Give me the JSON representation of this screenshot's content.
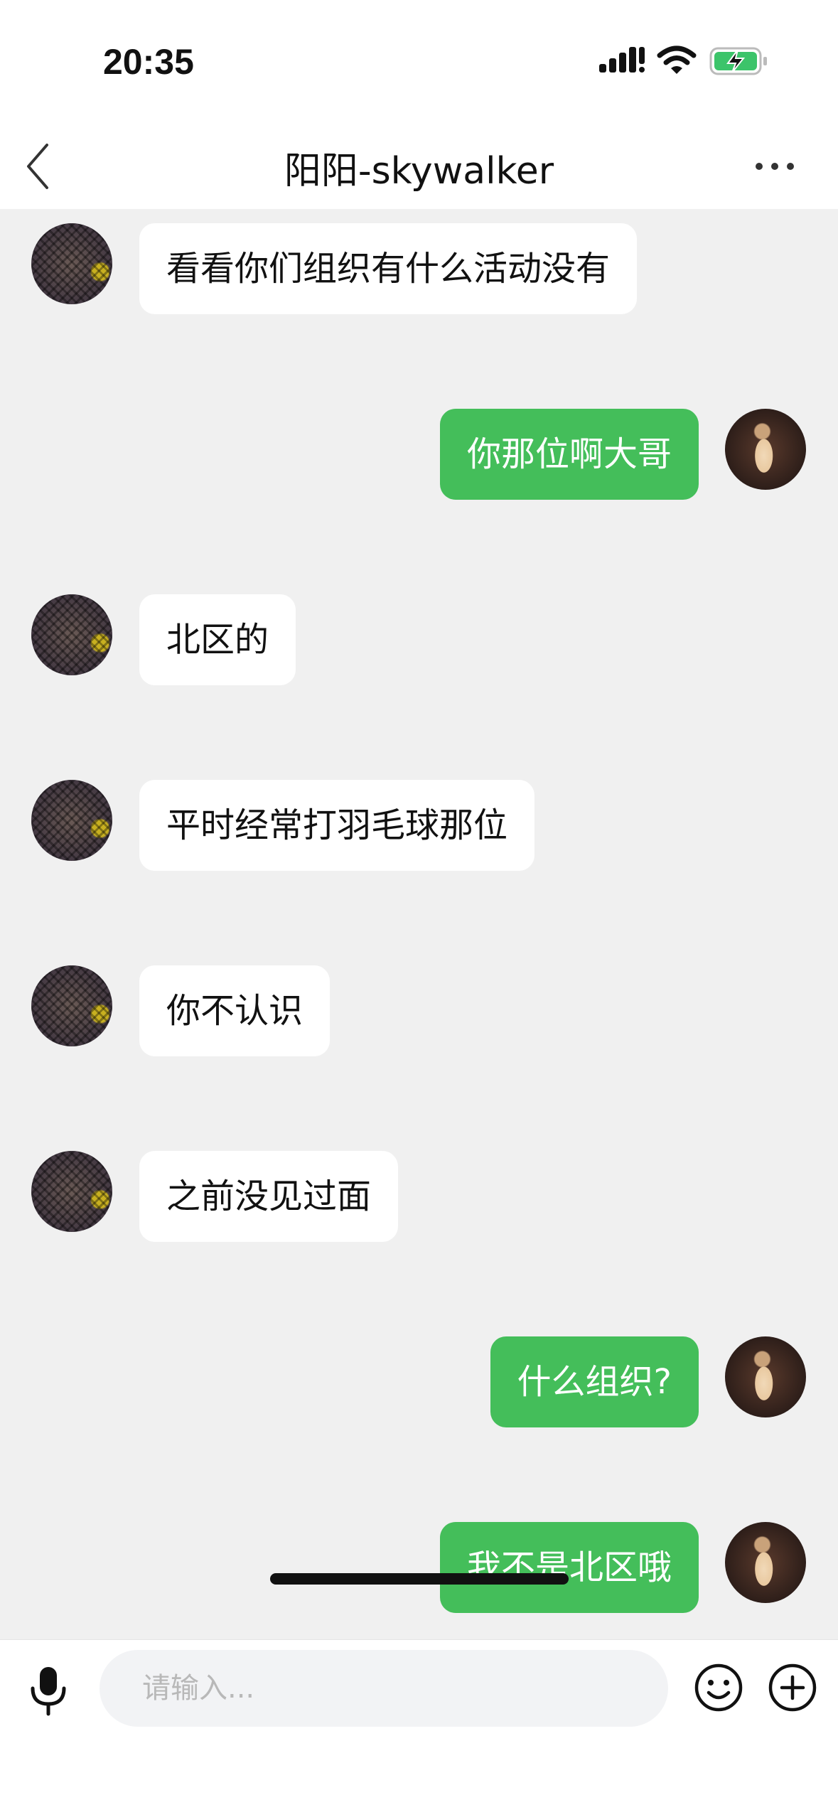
{
  "status_bar": {
    "time": "20:35"
  },
  "header": {
    "title": "阳阳-skywalker",
    "back_icon": "chevron-left-icon",
    "more_icon": "ellipsis-icon"
  },
  "messages": [
    {
      "side": "left",
      "text": "看看你们组织有什么活动没有"
    },
    {
      "side": "right",
      "text": "你那位啊大哥"
    },
    {
      "side": "left",
      "text": "北区的"
    },
    {
      "side": "left",
      "text": "平时经常打羽毛球那位"
    },
    {
      "side": "left",
      "text": "你不认识"
    },
    {
      "side": "left",
      "text": "之前没见过面"
    },
    {
      "side": "right",
      "text": "什么组织?"
    },
    {
      "side": "right",
      "text": "我不是北区哦"
    }
  ],
  "input_bar": {
    "placeholder": "请输入...",
    "value": "",
    "icons": [
      "microphone-icon",
      "emoji-icon",
      "plus-icon"
    ]
  },
  "colors": {
    "chat_background": "#f0f0f0",
    "outgoing_bubble": "#44be5a",
    "incoming_bubble": "#ffffff",
    "battery_charging": "#3cc46a"
  }
}
